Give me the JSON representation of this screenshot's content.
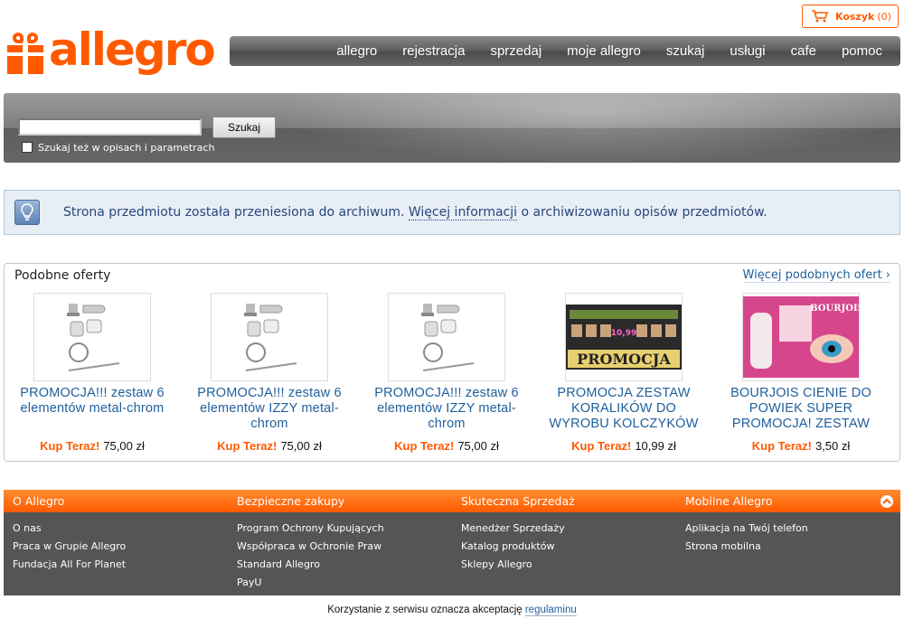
{
  "brand": {
    "logo_text": "allegro",
    "logo_icon": "gift-icon",
    "accent": "#ff5a00"
  },
  "cart": {
    "label": "Koszyk",
    "count": "(0)",
    "icon": "cart-icon"
  },
  "nav": {
    "items": [
      "allegro",
      "rejestracja",
      "sprzedaj",
      "moje allegro",
      "szukaj",
      "usługi",
      "cafe",
      "pomoc"
    ]
  },
  "search": {
    "value": "",
    "button_label": "Szukaj",
    "checkbox_label": "Szukaj też w opisach i parametrach",
    "checkbox_checked": false
  },
  "info": {
    "icon": "lightbulb-icon",
    "text_before": "Strona przedmiotu została przeniesiona do archiwum. ",
    "link_text": "Więcej informacji",
    "text_after": " o archiwizowaniu opisów przedmiotów."
  },
  "similar": {
    "title": "Podobne oferty",
    "more_link": "Więcej podobnych ofert ›",
    "offers": [
      {
        "title": "PROMOCJA!!! zestaw 6 elementów metal-chrom",
        "buy_now": "Kup Teraz!",
        "price": "75,00 zł",
        "image": "bathroom-set"
      },
      {
        "title": "PROMOCJA!!! zestaw 6 elementów IZZY metal-chrom",
        "buy_now": "Kup Teraz!",
        "price": "75,00 zł",
        "image": "bathroom-set"
      },
      {
        "title": "PROMOCJA!!! zestaw 6 elementów IZZY metal-chrom",
        "buy_now": "Kup Teraz!",
        "price": "75,00 zł",
        "image": "bathroom-set"
      },
      {
        "title": "PROMOCJA ZESTAW KORALIKÓW DO WYROBU KOLCZYKÓW",
        "buy_now": "Kup Teraz!",
        "price": "10,99 zł",
        "image": "beads-promo",
        "image_text": "PROMOCJA",
        "image_price": "10,99"
      },
      {
        "title": "BOURJOIS CIENIE DO POWIEK SUPER PROMOCJA! ZESTAW",
        "buy_now": "Kup Teraz!",
        "price": "3,50 zł",
        "image": "bourjois-promo",
        "image_text": "BOURJOIS"
      }
    ]
  },
  "footer": {
    "columns": [
      {
        "title": "O Allegro",
        "links": [
          "O nas",
          "Praca w Grupie Allegro",
          "Fundacja All For Planet"
        ]
      },
      {
        "title": "Bezpieczne zakupy",
        "links": [
          "Program Ochrony Kupujących",
          "Współpraca w Ochronie Praw",
          "Standard Allegro",
          "PayU"
        ]
      },
      {
        "title": "Skuteczna Sprzedaż",
        "links": [
          "Menedżer Sprzedaży",
          "Katalog produktów",
          "Sklepy Allegro"
        ]
      },
      {
        "title": "Mobilne Allegro",
        "links": [
          "Aplikacja na Twój telefon",
          "Strona mobilna"
        ]
      }
    ],
    "collapse_icon": "chevron-up-icon"
  },
  "legal": {
    "text": "Korzystanie z serwisu oznacza akceptację ",
    "link": "regulaminu"
  }
}
